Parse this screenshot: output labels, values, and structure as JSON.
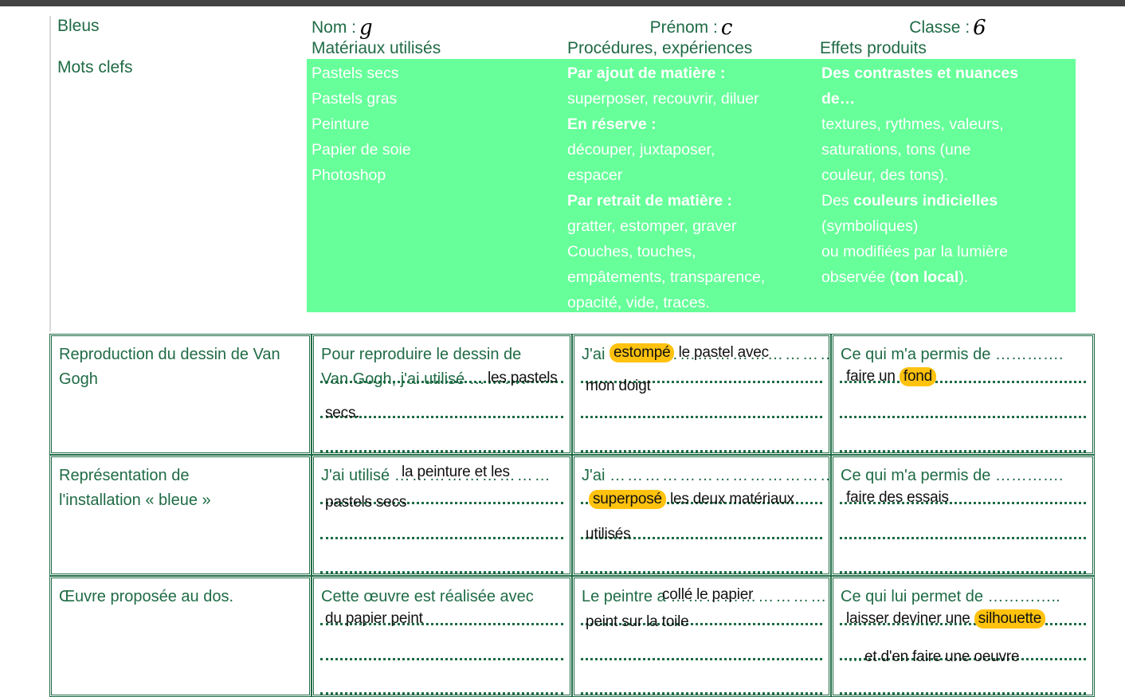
{
  "document": {
    "theme_title": "Bleus",
    "keywords_label": "Mots clefs"
  },
  "identity": {
    "nom_label": "Nom :",
    "nom_value": "g",
    "prenom_label": "Prénom :",
    "prenom_value": "c",
    "classe_label": "Classe :",
    "classe_value": "6"
  },
  "columns": {
    "materials": "Matériaux utilisés",
    "procedures": "Procédures, expériences",
    "effects": "Effets produits"
  },
  "keyword_cells": {
    "materials": [
      "Pastels secs",
      "Pastels gras",
      "Peinture",
      "Papier de soie",
      "Photoshop"
    ],
    "procedures": {
      "h1": "Par ajout de matière :",
      "l1": "superposer, recouvrir, diluer",
      "h2": "En réserve :",
      "l2": "découper, juxtaposer,",
      "l3": "espacer",
      "h3": "Par retrait de matière :",
      "l4": "gratter, estomper, graver",
      "l5": "Couches, touches,",
      "l6": "empâtements, transparence,",
      "l7": "opacité, vide, traces."
    },
    "effects": {
      "h1a": "Des ",
      "h1b": "contrastes et nuances",
      "h2": "de…",
      "l1": "textures, rythmes, valeurs,",
      "l2": "saturations, tons (une",
      "l3": "couleur, des tons).",
      "l4a": "Des ",
      "l4b": "couleurs indicielles",
      "l5": "(symboliques)",
      "l6": "ou modifiées par la lumière",
      "l7a": "observée (",
      "l7b": "ton local",
      "l7c": ")."
    }
  },
  "rows": [
    {
      "subject": "Reproduction du dessin de Van Gogh",
      "materials": {
        "prompt_l1": "Pour reproduire le dessin de",
        "prompt_l2": "Van Gogh, j'ai utilisé ",
        "answer_1": "les pastels",
        "answer_2": "secs."
      },
      "procedures": {
        "prompt": "J'ai ",
        "answer_hl": "estompé",
        "answer_rest": " le pastel avec",
        "dots_tail": "………",
        "answer_2": "mon doigt"
      },
      "effects": {
        "prompt": "Ce qui m'a permis de ………….",
        "answer_pre": "faire un ",
        "answer_hl": "fond"
      }
    },
    {
      "subject_l1": "Représentation de",
      "subject_l2": "l'installation « bleue »",
      "materials": {
        "prompt_l1": "J'ai utilisé ",
        "answer_1": "la peinture et les",
        "answer_2": "pastels secs"
      },
      "procedures": {
        "prompt": "J'ai ",
        "answer_hl": "superposé",
        "answer_rest": " les deux matériaux",
        "answer_2": "utilisés"
      },
      "effects": {
        "prompt": "Ce qui m'a permis de ………….",
        "answer_1": "faire des essais"
      }
    },
    {
      "subject": "Œuvre proposée au dos.",
      "materials": {
        "prompt_l1": "Cette œuvre est réalisée avec",
        "answer_1": "du papier peint"
      },
      "procedures": {
        "prompt": "Le peintre a ",
        "answer_1": "collé le papier",
        "dots_tail": "……",
        "answer_2": "peint sur la toile"
      },
      "effects": {
        "prompt": "Ce qui lui permet de …………..",
        "answer_pre": "laisser deviner une ",
        "answer_hl": "silhouette",
        "answer_2": "et d'en faire une oeuvre"
      }
    }
  ],
  "colors": {
    "green_fill": "#66FF99",
    "green_text": "#1f6b45",
    "highlight": "#FFC20E",
    "chrome": "#434343"
  }
}
